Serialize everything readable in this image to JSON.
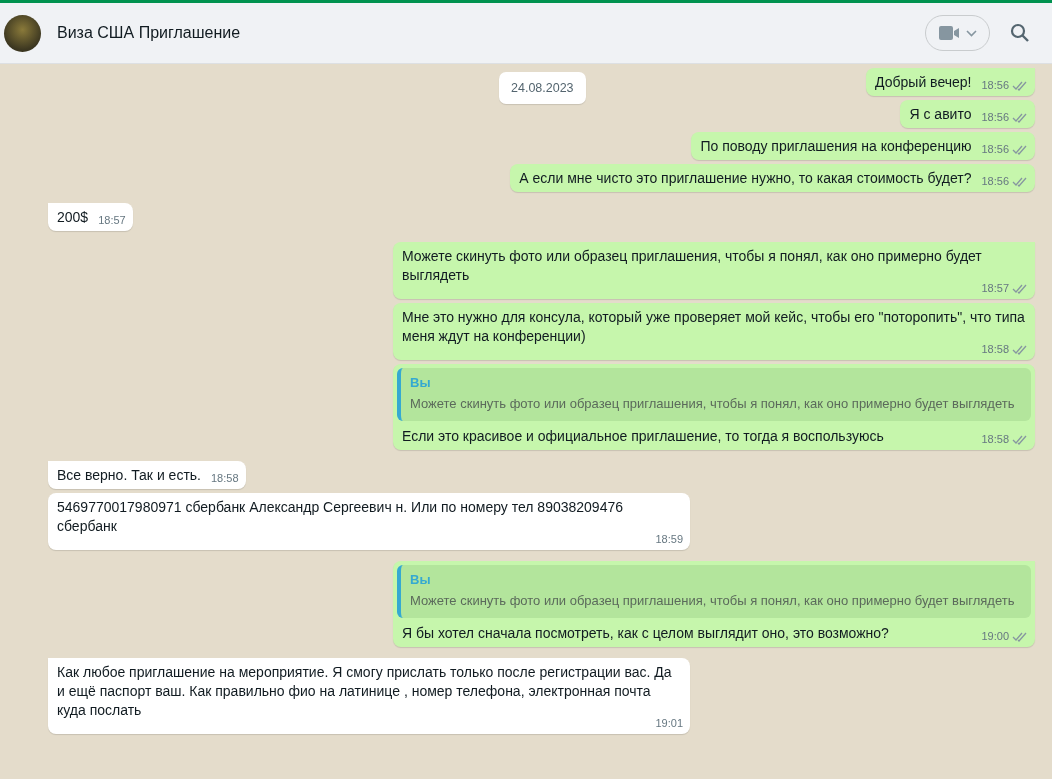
{
  "header": {
    "title": "Виза США Приглашение"
  },
  "date_badge": "24.08.2023",
  "messages": [
    {
      "kind": "text",
      "out": true,
      "text": "Добрый вечер!",
      "time": "18:56",
      "read": true
    },
    {
      "kind": "text",
      "out": true,
      "text": "Я с авито",
      "time": "18:56",
      "read": true
    },
    {
      "kind": "text",
      "out": true,
      "text": "По поводу приглашения на конференцию",
      "time": "18:56",
      "read": true
    },
    {
      "kind": "text",
      "out": true,
      "text": "А если мне чисто это приглашение нужно, то какая стоимость будет?",
      "time": "18:56",
      "read": true
    },
    {
      "kind": "text",
      "out": false,
      "text": "200$",
      "time": "18:57"
    },
    {
      "kind": "text",
      "out": true,
      "text": "Можете скинуть фото или образец приглашения, чтобы я понял, как оно примерно будет выглядеть",
      "time": "18:57",
      "read": true
    },
    {
      "kind": "text",
      "out": true,
      "text": "Мне это нужно для консула, который уже проверяет мой кейс, чтобы его \"поторопить\", что типа меня ждут на конференции)",
      "time": "18:58",
      "read": true
    },
    {
      "kind": "reply",
      "out": true,
      "quote_author": "Вы",
      "quote_text": "Можете скинуть фото или образец приглашения, чтобы я понял, как оно примерно будет выглядеть",
      "text": "Если это красивое и официальное приглашение, то тогда я воспользуюсь",
      "time": "18:58",
      "read": true
    },
    {
      "kind": "text",
      "out": false,
      "text": "Все верно. Так и есть.",
      "time": "18:58"
    },
    {
      "kind": "text",
      "out": false,
      "text": "5469770017980971 сбербанк Александр Сергеевич н.  Или по номеру тел 89038209476 сбербанк",
      "time": "18:59"
    },
    {
      "kind": "reply",
      "out": true,
      "quote_author": "Вы",
      "quote_text": "Можете скинуть фото или образец приглашения, чтобы я понял, как оно примерно будет выглядеть",
      "text": "Я бы хотел сначала посмотреть, как с целом выглядит оно, это возможно?",
      "time": "19:00",
      "read": true
    },
    {
      "kind": "text",
      "out": false,
      "text": "Как любое приглашение на мероприятие. Я смогу прислать только после регистрации вас. Да и ещё паспорт ваш. Как правильно фио на латинице , номер телефона,  электронная почта куда послать",
      "time": "19:01"
    }
  ]
}
